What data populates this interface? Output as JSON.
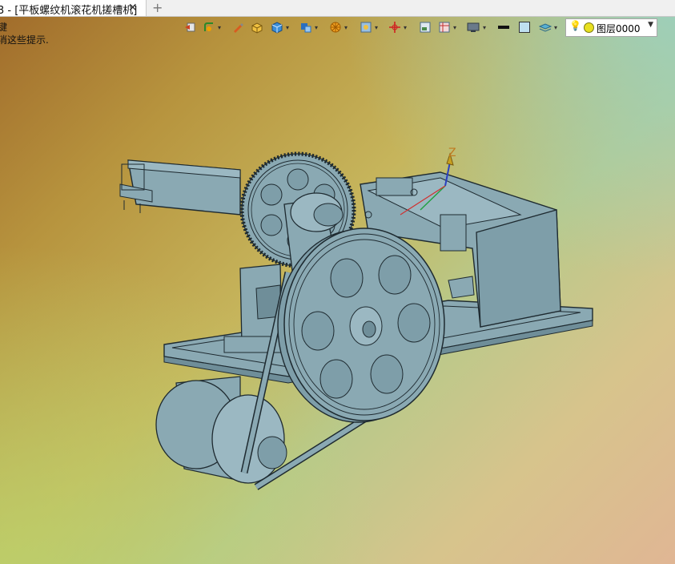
{
  "tab": {
    "title": "3 - [平板螺纹机滚花机搓槽机]",
    "close_glyph": "✕",
    "add_glyph": "+"
  },
  "hints": {
    "line1": "键",
    "line2": "消这些提示."
  },
  "toolbar": {
    "icons": [
      "undo-icon",
      "fillet-icon",
      "pen-icon",
      "box-icon",
      "solid-icon",
      "shape-icon",
      "wheel-icon",
      "view-icon",
      "axis-icon",
      "panel-icon",
      "table-icon",
      "display-icon",
      "line-weight-icon",
      "color-icon",
      "layer-stack-icon"
    ],
    "layer_label": "图层0000"
  },
  "axis": {
    "z_label": "Z"
  },
  "colors": {
    "model_fill": "#8aa9b3",
    "model_stroke": "#1e2a30",
    "model_dark": "#6f8e99"
  }
}
